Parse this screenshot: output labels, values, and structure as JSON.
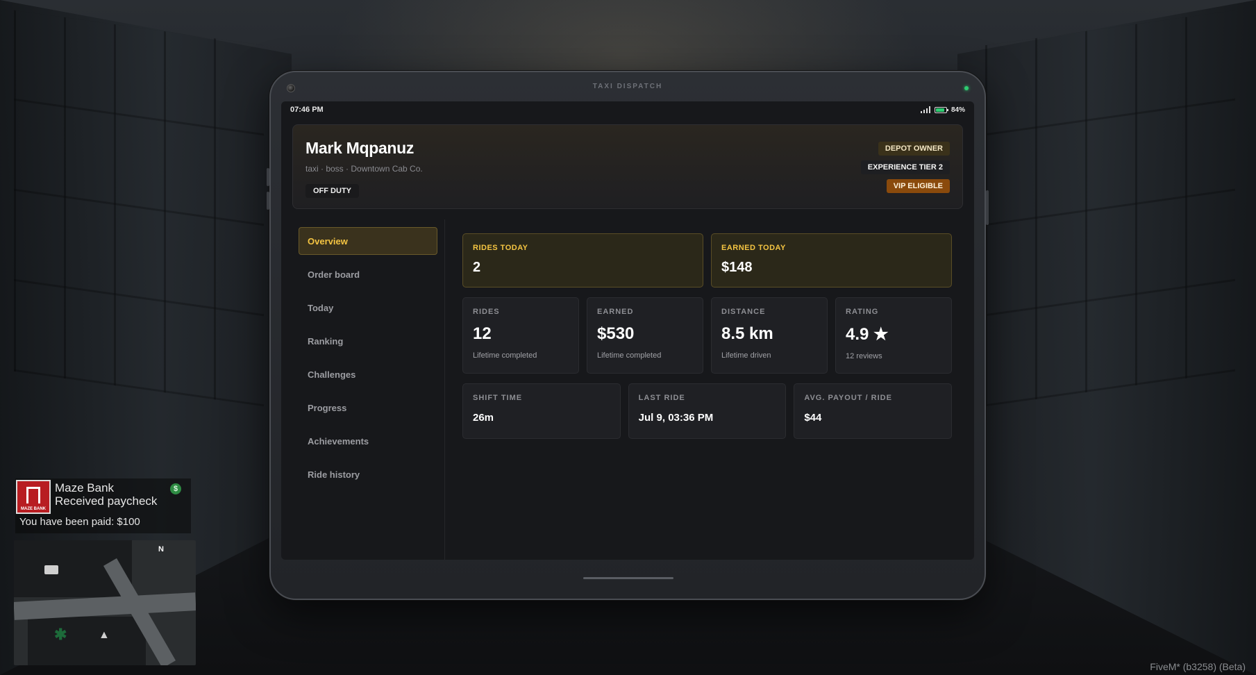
{
  "tablet": {
    "brand": "TAXI DISPATCH"
  },
  "statusbar": {
    "time": "07:46 PM",
    "battery": "84%",
    "battery_level": 0.84
  },
  "profile": {
    "name": "Mark Mqpanuz",
    "subtitle": "taxi · boss · Downtown Cab Co.",
    "duty_status": "OFF DUTY",
    "badges": [
      {
        "label": "DEPOT OWNER",
        "color": "#3a311a"
      },
      {
        "label": "EXPERIENCE TIER 2",
        "color": "#1e1f22"
      },
      {
        "label": "VIP ELIGIBLE",
        "color": "#8a4a0c"
      }
    ]
  },
  "sidebar": {
    "items": [
      {
        "label": "Overview",
        "active": true
      },
      {
        "label": "Order board",
        "active": false
      },
      {
        "label": "Today",
        "active": false
      },
      {
        "label": "Ranking",
        "active": false
      },
      {
        "label": "Challenges",
        "active": false
      },
      {
        "label": "Progress",
        "active": false
      },
      {
        "label": "Achievements",
        "active": false
      },
      {
        "label": "Ride history",
        "active": false
      }
    ]
  },
  "overview": {
    "today": [
      {
        "label": "RIDES TODAY",
        "value": "2"
      },
      {
        "label": "EARNED TODAY",
        "value": "$148"
      }
    ],
    "lifetime": [
      {
        "label": "RIDES",
        "value": "12",
        "note": "Lifetime completed"
      },
      {
        "label": "EARNED",
        "value": "$530",
        "note": "Lifetime completed"
      },
      {
        "label": "DISTANCE",
        "value": "8.5 km",
        "note": "Lifetime driven"
      },
      {
        "label": "RATING",
        "value": "4.9 ★",
        "note": "12 reviews"
      }
    ],
    "shift": [
      {
        "label": "SHIFT TIME",
        "value": "26m"
      },
      {
        "label": "LAST RIDE",
        "value": "Jul 9, 03:36 PM"
      },
      {
        "label": "AVG. PAYOUT / RIDE",
        "value": "$44"
      }
    ]
  },
  "hud": {
    "notification": {
      "sender": "Maze Bank",
      "subject": "Received paycheck",
      "body": "You have been paid: $100",
      "logo_text": "MAZE BANK",
      "icon": "dollar-icon"
    },
    "minimap": {
      "north": "N"
    },
    "watermark": "FiveM* (b3258) (Beta)"
  },
  "colors": {
    "accent": "#f5c542",
    "vip": "#8a4a0c",
    "online": "#2ecc71"
  }
}
